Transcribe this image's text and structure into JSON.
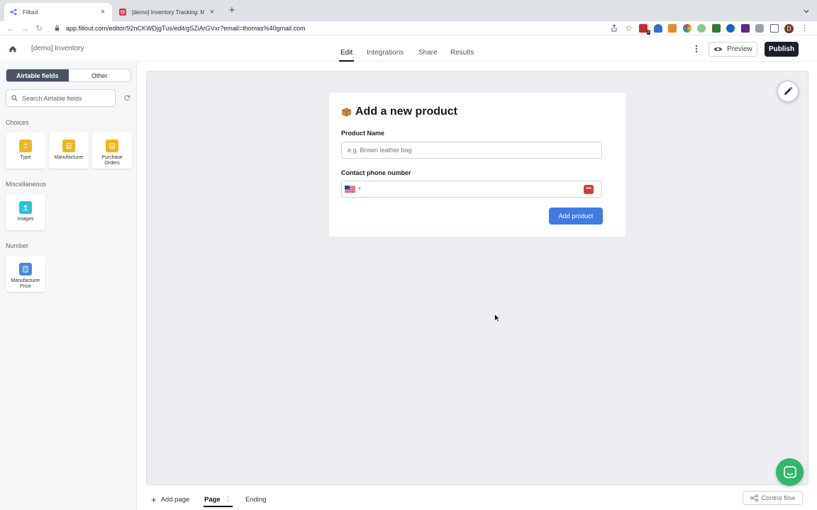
{
  "browser": {
    "tabs": [
      {
        "title": "Fillout",
        "active": true
      },
      {
        "title": "[demo] Inventory Tracking: Ma",
        "active": false
      }
    ],
    "url": "app.fillout.com/editor/92nCKWDjgTus/edit/gSZiArGVxr?email=thomas%40gmail.com",
    "profile_initial": "D",
    "ext_badge": "2"
  },
  "header": {
    "form_name": "[demo] Inventory",
    "tabs": [
      "Edit",
      "Integrations",
      "Share",
      "Results"
    ],
    "active_tab": "Edit",
    "preview_label": "Preview",
    "publish_label": "Publish"
  },
  "sidebar": {
    "toggle": [
      "Airtable fields",
      "Other"
    ],
    "search_placeholder": "Search Airtable fields",
    "sections": [
      {
        "title": "Choices",
        "fields": [
          {
            "label": "Type",
            "color": "#f2b51e"
          },
          {
            "label": "Manufacturer",
            "color": "#f2b51e"
          },
          {
            "label": "Purchase Orders",
            "color": "#f2b51e"
          }
        ]
      },
      {
        "title": "Miscellaneous",
        "fields": [
          {
            "label": "Images",
            "color": "#26c6d4"
          }
        ]
      },
      {
        "title": "Number",
        "fields": [
          {
            "label": "Manufacturer Price",
            "color": "#4a8be0"
          }
        ]
      }
    ]
  },
  "form": {
    "title": "Add a new product",
    "fields": [
      {
        "label": "Product Name",
        "placeholder": "e.g. Brown leather bag"
      },
      {
        "label": "Contact phone number",
        "placeholder": ""
      }
    ],
    "submit_label": "Add product",
    "pw_badge": "•••"
  },
  "bottom": {
    "add_page": "Add page",
    "page": "Page",
    "ending": "Ending",
    "control_flow": "Control flow"
  }
}
